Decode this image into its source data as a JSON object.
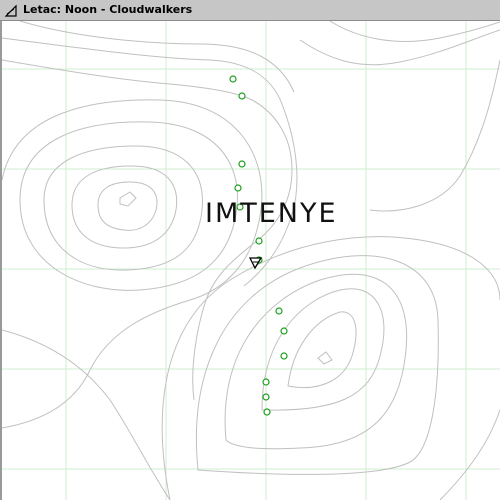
{
  "window": {
    "title": "Letac: Noon - Cloudwalkers",
    "icon": "sail-icon"
  },
  "map": {
    "place_label": "IMTENYE",
    "grid_color": "#cfeecf",
    "contour_color": "#c0c0c0",
    "waypoint_color": "#1a9e1a",
    "player_marker": "player-arrow-icon"
  }
}
